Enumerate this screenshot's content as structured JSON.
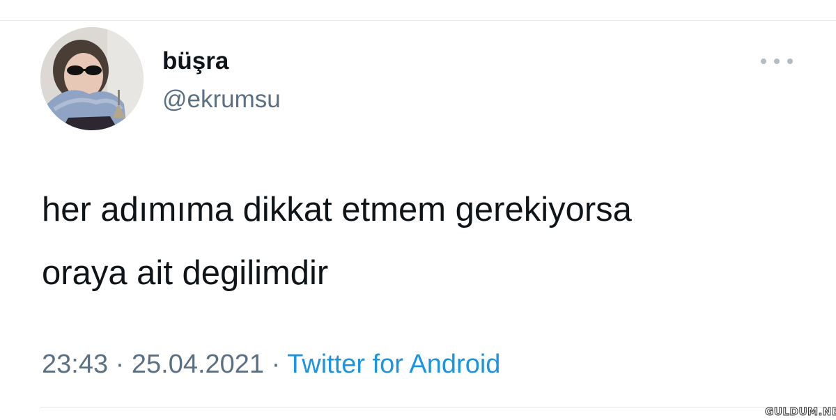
{
  "tweet": {
    "author": {
      "display_name": "büşra",
      "handle": "@ekrumsu"
    },
    "text_lines": [
      "her adımıma dikkat etmem gerekiyorsa",
      "oraya ait degilimdir"
    ],
    "time": "23:43",
    "separator": "·",
    "date": "25.04.2021",
    "source": "Twitter for Android"
  },
  "icons": {
    "more": "more-horizontal-icon"
  },
  "colors": {
    "text": "#0f1419",
    "secondary": "#5b7083",
    "link": "#1b95e0"
  },
  "watermark": "GULDUM.NET"
}
